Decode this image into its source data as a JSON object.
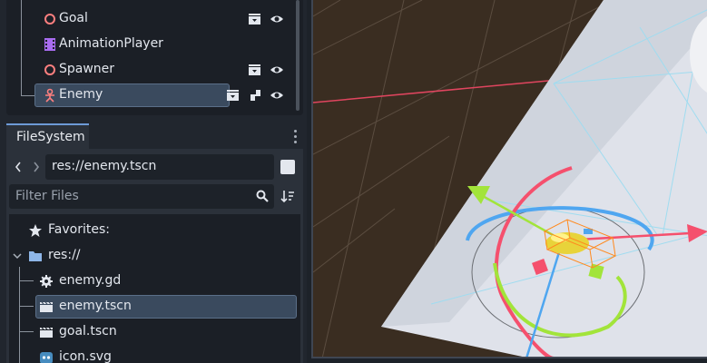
{
  "scene_tree": {
    "nodes": [
      {
        "label": "Goal",
        "icon": "area-node-icon"
      },
      {
        "label": "AnimationPlayer",
        "icon": "animation-player-icon"
      },
      {
        "label": "Spawner",
        "icon": "area-node-icon"
      },
      {
        "label": "Enemy",
        "icon": "character-body-icon",
        "selected": true
      }
    ]
  },
  "filesystem": {
    "tab_label": "FileSystem",
    "path": "res://enemy.tscn",
    "filter_placeholder": "Filter Files",
    "items": [
      {
        "label": "Favorites:",
        "icon": "star-icon"
      },
      {
        "label": "res://",
        "icon": "folder-icon"
      },
      {
        "label": "enemy.gd",
        "icon": "gear-script-icon"
      },
      {
        "label": "enemy.tscn",
        "icon": "scene-file-icon",
        "selected": true
      },
      {
        "label": "goal.tscn",
        "icon": "scene-file-icon"
      },
      {
        "label": "icon.svg",
        "icon": "godot-image-icon"
      }
    ]
  },
  "colors": {
    "accent": "#6d9ad6",
    "selection": "#3a4a5e",
    "node_red": "#fc7f7f",
    "anim_purple": "#a86cf0",
    "gizmo_red": "#f5506d",
    "gizmo_green": "#a2e43a",
    "gizmo_blue": "#4fa6f0"
  }
}
